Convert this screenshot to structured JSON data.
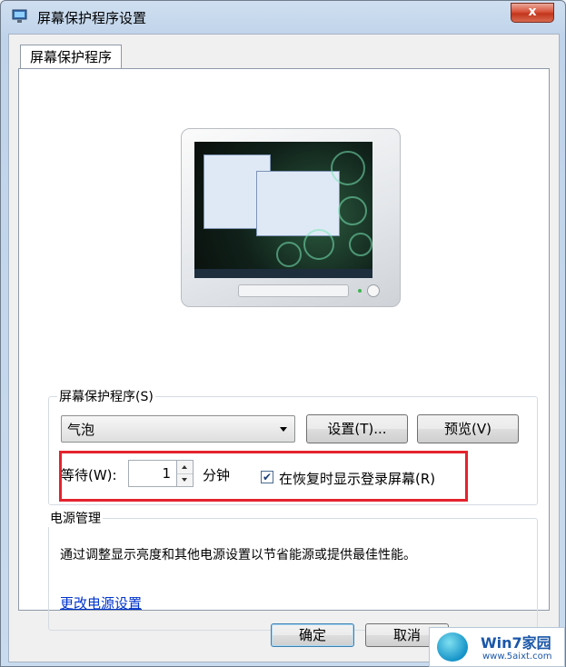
{
  "window": {
    "title": "屏幕保护程序设置",
    "close_label": "x"
  },
  "tabs": [
    {
      "label": "屏幕保护程序"
    }
  ],
  "screensaver_group": {
    "label": "屏幕保护程序(S)",
    "selected": "气泡",
    "settings_button": "设置(T)...",
    "preview_button": "预览(V)",
    "wait_label": "等待(W):",
    "wait_value": "1",
    "wait_unit": "分钟",
    "resume_checkbox": {
      "label": "在恢复时显示登录屏幕(R)",
      "checked": true
    }
  },
  "power_group": {
    "label": "电源管理",
    "description": "通过调整显示亮度和其他电源设置以节省能源或提供最佳性能。",
    "link": "更改电源设置"
  },
  "footer": {
    "ok_button": "确定",
    "cancel_button": "取消"
  },
  "watermark": {
    "title": "Win7家园",
    "url": "www.5aixt.com"
  },
  "colors": {
    "highlight_border": "#e4232e",
    "link": "#0033cc"
  }
}
